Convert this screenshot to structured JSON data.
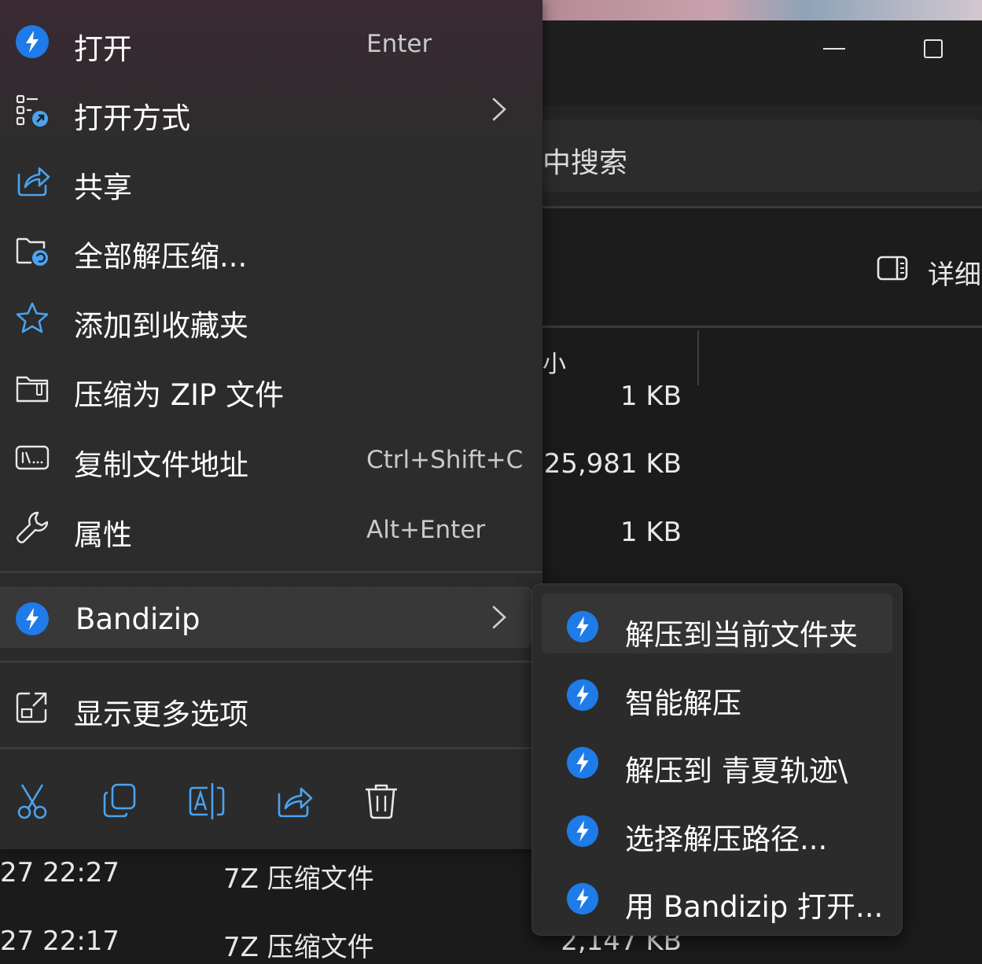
{
  "explorer": {
    "search_label": "中搜索",
    "details_label": "详细",
    "size_column_header": "小",
    "rows": [
      {
        "size": "1 KB"
      },
      {
        "size": "25,981 KB"
      },
      {
        "size": "1 KB"
      }
    ],
    "bottom_rows": [
      {
        "date": "27 22:27",
        "type": "7Z 压缩文件",
        "size": ""
      },
      {
        "date": "27 22:17",
        "type": "7Z 压缩文件",
        "size": "2,147 KB"
      }
    ]
  },
  "context_menu": {
    "items": [
      {
        "label": "打开",
        "shortcut": "Enter",
        "icon": "bandizip-icon"
      },
      {
        "label": "打开方式",
        "shortcut": "",
        "icon": "open-with-icon",
        "has_submenu": true
      },
      {
        "label": "共享",
        "shortcut": "",
        "icon": "share-icon"
      },
      {
        "label": "全部解压缩...",
        "shortcut": "",
        "icon": "extract-all-icon"
      },
      {
        "label": "添加到收藏夹",
        "shortcut": "",
        "icon": "star-icon"
      },
      {
        "label": "压缩为 ZIP 文件",
        "shortcut": "",
        "icon": "zip-folder-icon"
      },
      {
        "label": "复制文件地址",
        "shortcut": "Ctrl+Shift+C",
        "icon": "copy-path-icon"
      },
      {
        "label": "属性",
        "shortcut": "Alt+Enter",
        "icon": "wrench-icon"
      }
    ],
    "bandizip": {
      "label": "Bandizip",
      "icon": "bandizip-icon",
      "has_submenu": true
    },
    "show_more": {
      "label": "显示更多选项",
      "icon": "show-more-icon"
    },
    "toolbar": [
      "cut-icon",
      "copy-icon",
      "rename-icon",
      "share-icon",
      "delete-icon"
    ]
  },
  "submenu": {
    "items": [
      {
        "label": "解压到当前文件夹"
      },
      {
        "label": "智能解压"
      },
      {
        "label": "解压到 青夏轨迹\\"
      },
      {
        "label": "选择解压路径..."
      },
      {
        "label": "用 Bandizip 打开..."
      }
    ]
  },
  "colors": {
    "menu_bg": "#2b2b2b",
    "bandizip_blue": "#1e7be8",
    "accent_icon": "#4aa3f0"
  }
}
